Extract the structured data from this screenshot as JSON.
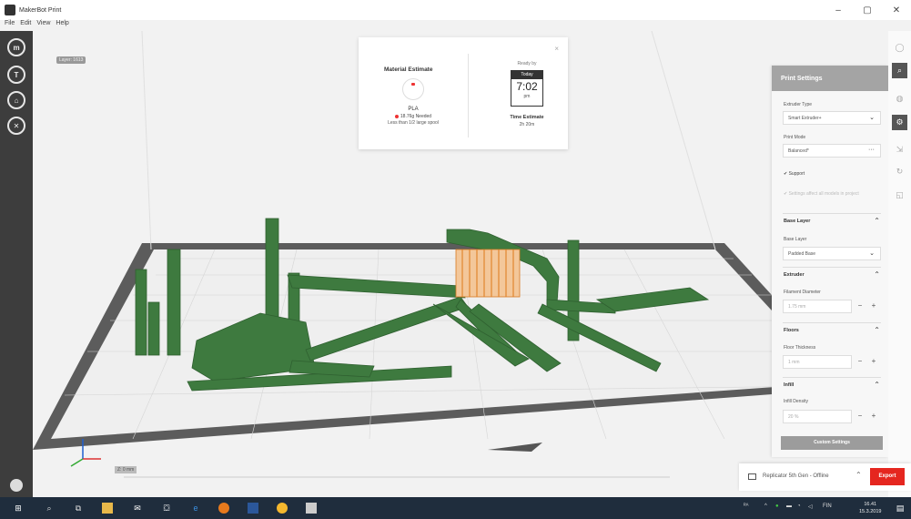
{
  "window": {
    "title": "MakerBot Print",
    "minimize": "–",
    "maximize": "▢",
    "close": "✕"
  },
  "menu": [
    "File",
    "Edit",
    "View",
    "Help"
  ],
  "left_rail": {
    "items": [
      {
        "name": "makerbot-logo-icon",
        "glyph": "m"
      },
      {
        "name": "thingiverse-icon",
        "glyph": "T"
      },
      {
        "name": "home-icon",
        "glyph": "⌂"
      },
      {
        "name": "close-circle-icon",
        "glyph": "✕"
      }
    ]
  },
  "viewport": {
    "layer_badge": "Layer: 1613",
    "bottom_label": "Z: 0 mm",
    "colors": {
      "model": "#3e7a3f",
      "support": "#e0862e",
      "plate": "#595959",
      "grid": "#e8e8e8"
    }
  },
  "estimate": {
    "close": "×",
    "material_title": "Material Estimate",
    "material_name": "PLA",
    "material_needed": "18.76g Needed",
    "material_spool": "Less than 1/2 large spool",
    "ready_by": "Ready by",
    "calendar_day": "Today",
    "calendar_time": "7:02",
    "calendar_ampm": "pm",
    "time_title": "Time Estimate",
    "time_value": "2h 20m"
  },
  "print_settings": {
    "title": "Print Settings",
    "extruder_type_label": "Extruder Type",
    "extruder_type_value": "Smart Extruder+",
    "print_mode_label": "Print Mode",
    "print_mode_value": "Balanced*",
    "print_mode_more": "···",
    "support_label": "Support",
    "apply_all_label": "Settings affect all models in project",
    "base_layer_section": "Base Layer",
    "base_layer_label": "Base Layer",
    "base_layer_value": "Padded Base",
    "extruder_section": "Extruder",
    "filament_label": "Filament Diameter",
    "filament_value": "1.75 mm",
    "floors_section": "Floors",
    "floor_thickness_label": "Floor Thickness",
    "floor_thickness_value": "1 mm",
    "infill_section": "Infill",
    "infill_density_label": "Infill Density",
    "infill_density_value": "20 %",
    "minus": "−",
    "plus": "+",
    "caret_up": "⌃",
    "caret_down": "⌄",
    "custom_settings": "Custom Settings"
  },
  "right_rail": {
    "items": [
      {
        "name": "view-icon",
        "glyph": "◯",
        "active": false
      },
      {
        "name": "search-icon",
        "glyph": "⌕",
        "active": true
      },
      {
        "name": "info-icon",
        "glyph": "◍",
        "active": false
      },
      {
        "name": "settings-icon",
        "glyph": "⚙",
        "active": true
      },
      {
        "name": "move-icon",
        "glyph": "⇲",
        "active": false
      },
      {
        "name": "rotate-icon",
        "glyph": "↻",
        "active": false
      },
      {
        "name": "scale-icon",
        "glyph": "◱",
        "active": false
      }
    ]
  },
  "printer": {
    "name": "Replicator 5th Gen - Offline",
    "caret": "⌃",
    "export": "Export"
  },
  "taskbar": {
    "tray_items": [
      "ᴿᴬ",
      "^",
      "EN",
      "FIN"
    ],
    "time": "16.41",
    "date": "15.3.2019"
  }
}
